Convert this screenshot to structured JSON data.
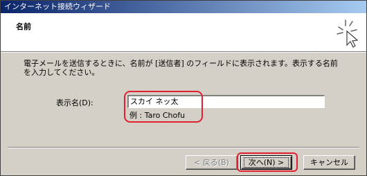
{
  "window": {
    "title": "インターネット接続ウィザード"
  },
  "header": {
    "title": "名前",
    "icon": "wizard-sparkle-icon"
  },
  "instruction": "電子メールを送信するときに、名前が [送信者] のフィールドに表示されます。表示する名前を入力してください。",
  "form": {
    "label": "表示名(D):",
    "value": "スカイ ネッ太",
    "example": "例 : Taro Chofu"
  },
  "buttons": {
    "back": "< 戻る(B)",
    "next": "次へ(N) >",
    "cancel": "キャンセル"
  },
  "colors": {
    "highlight": "#e02030",
    "titlebar_start": "#0a246a",
    "titlebar_end": "#a6caf0"
  }
}
